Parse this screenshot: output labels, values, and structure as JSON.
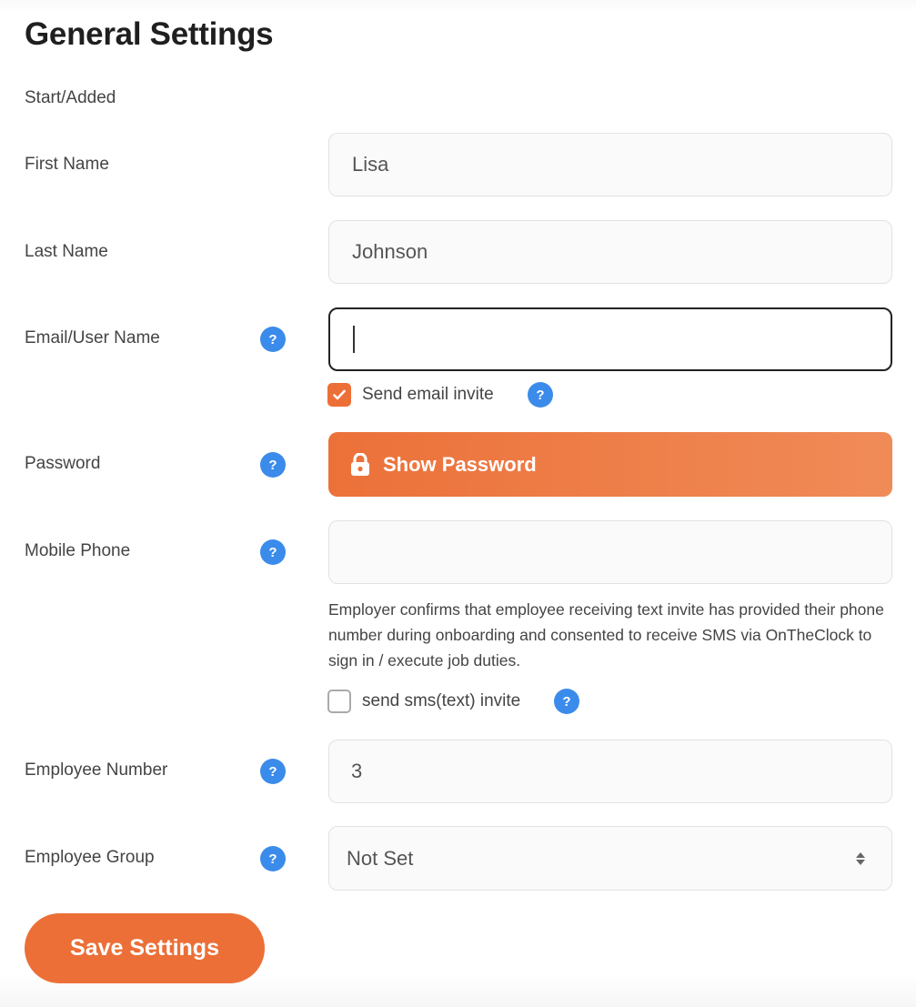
{
  "page": {
    "title": "General Settings",
    "start_added_label": "Start/Added"
  },
  "fields": {
    "first_name": {
      "label": "First Name",
      "value": "Lisa"
    },
    "last_name": {
      "label": "Last Name",
      "value": "Johnson"
    },
    "email": {
      "label": "Email/User Name",
      "value": "",
      "help_icon": "?"
    },
    "send_email_invite": {
      "label": "Send email invite",
      "checked": true,
      "help_icon": "?"
    },
    "password": {
      "label": "Password",
      "button_label": "Show Password",
      "icon": "lock-icon",
      "help_icon": "?"
    },
    "mobile_phone": {
      "label": "Mobile Phone",
      "value": "",
      "help_icon": "?",
      "consent_note": "Employer confirms that employee receiving text invite has provided their phone number during onboarding and consented to receive SMS via OnTheClock to sign in / execute job duties."
    },
    "send_sms_invite": {
      "label": "send sms(text) invite",
      "checked": false,
      "help_icon": "?"
    },
    "employee_number": {
      "label": "Employee Number",
      "value": "3",
      "help_icon": "?"
    },
    "employee_group": {
      "label": "Employee Group",
      "selected": "Not Set",
      "help_icon": "?"
    }
  },
  "actions": {
    "save_label": "Save Settings"
  },
  "colors": {
    "accent": "#ec6f37",
    "help": "#3b8beb"
  }
}
